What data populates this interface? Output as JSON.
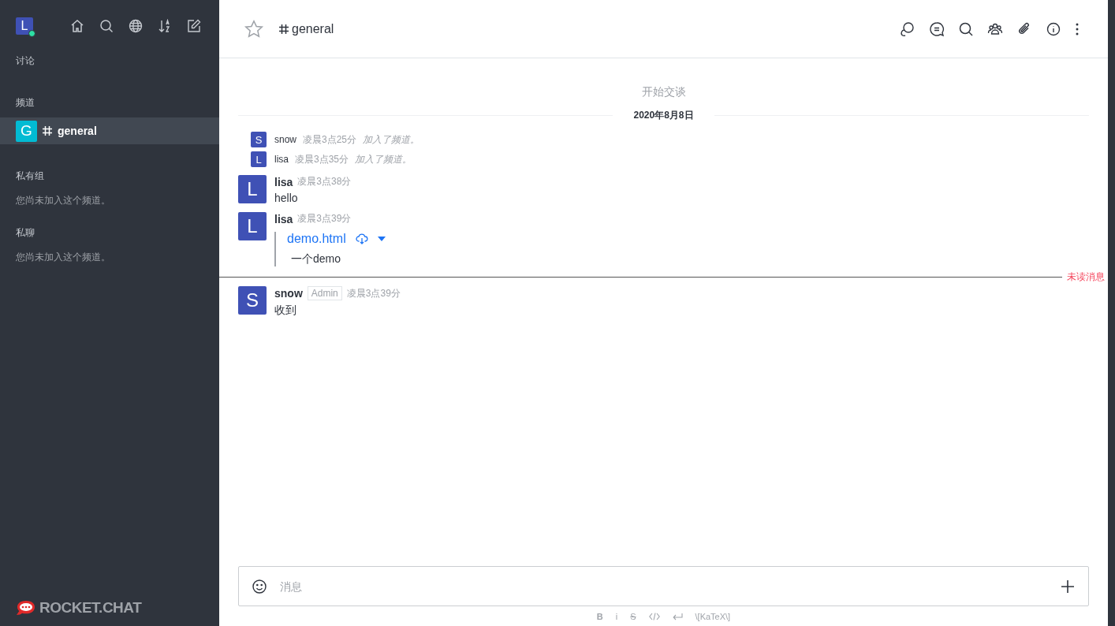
{
  "sidebar": {
    "user_avatar": {
      "letter": "L",
      "online": true
    },
    "sections": [
      {
        "title": "讨论",
        "kind": "label"
      },
      {
        "title": "频道",
        "kind": "channels",
        "items": [
          {
            "avatar": "G",
            "name": "general",
            "selected": true
          }
        ]
      },
      {
        "title": "私有组",
        "kind": "empty",
        "empty_text": "您尚未加入这个频道。"
      },
      {
        "title": "私聊",
        "kind": "empty",
        "empty_text": "您尚未加入这个频道。"
      }
    ],
    "logo_text": "ROCKET.CHAT"
  },
  "header": {
    "channel": "general",
    "starred": false
  },
  "timeline": {
    "start_text": "开始交谈",
    "date": "2020年8月8日",
    "messages": [
      {
        "kind": "system",
        "avatar": "S",
        "user": "snow",
        "time": "凌晨3点25分",
        "text": "加入了频道。"
      },
      {
        "kind": "system",
        "avatar": "L",
        "user": "lisa",
        "time": "凌晨3点35分",
        "text": "加入了频道。"
      },
      {
        "kind": "message",
        "avatar": "L",
        "user": "lisa",
        "time": "凌晨3点38分",
        "text": "hello"
      },
      {
        "kind": "file",
        "avatar": "L",
        "user": "lisa",
        "time": "凌晨3点39分",
        "file_name": "demo.html",
        "description": "一个demo"
      },
      {
        "kind": "unread",
        "label": "未读消息"
      },
      {
        "kind": "message",
        "avatar": "S",
        "user": "snow",
        "role": "Admin",
        "time": "凌晨3点39分",
        "text": "收到"
      }
    ]
  },
  "composer": {
    "placeholder": "消息",
    "format": [
      "B",
      "i",
      "S"
    ],
    "katex": "\\[KaTeX\\]"
  }
}
